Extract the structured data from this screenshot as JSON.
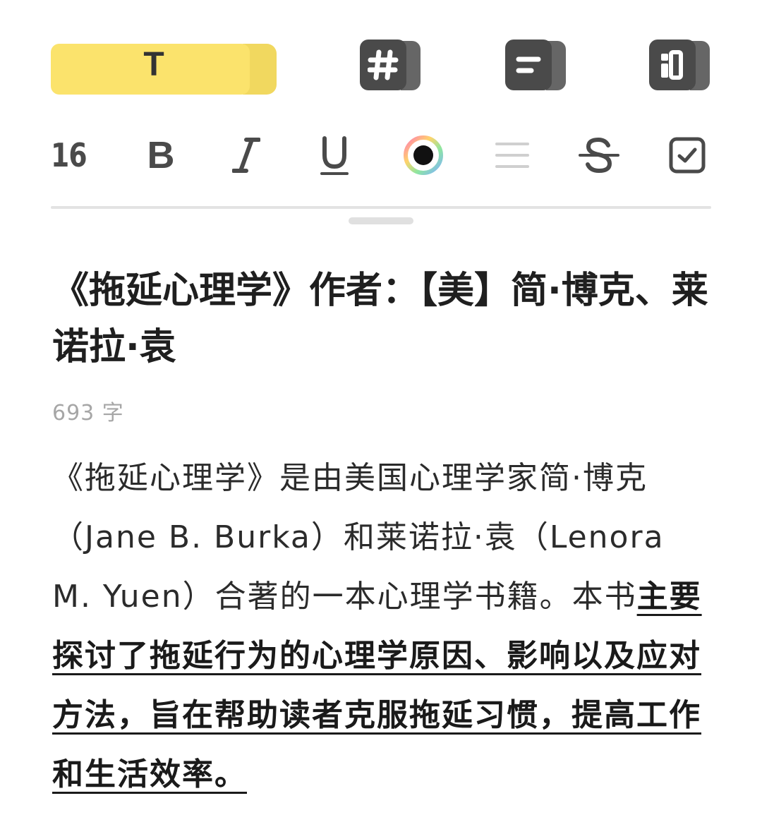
{
  "mode_tabs": {
    "text_tab_glyph": "T",
    "items": [
      {
        "icon": "hash-icon"
      },
      {
        "icon": "align-left-icon"
      },
      {
        "icon": "layout-icon"
      }
    ]
  },
  "format_toolbar": {
    "font_size": "16",
    "bold_glyph": "B",
    "italic_icon": "italic-icon",
    "underline_icon": "underline-icon",
    "color_icon": "color-picker-icon",
    "list_icon": "list-icon",
    "strike_icon": "strikethrough-icon",
    "checkbox_icon": "checkbox-icon"
  },
  "note": {
    "title": "《拖延心理学》作者：【美】简·博克、莱诺拉·袁",
    "word_count": "693 字",
    "body_plain": "《拖延心理学》是由美国心理学家简·博克（Jane B. Burka）和莱诺拉·袁（Lenora M. Yuen）合著的一本心理学书籍。本书",
    "body_emphasis": "主要探讨了拖延行为的心理学原因、影响以及应对方法，旨在帮助读者克服拖延习惯，提高工作和生活效率。"
  },
  "colors": {
    "accent_yellow": "#fbe36c",
    "icon_dark": "#4a4a4a",
    "muted": "#a6a6a6"
  }
}
